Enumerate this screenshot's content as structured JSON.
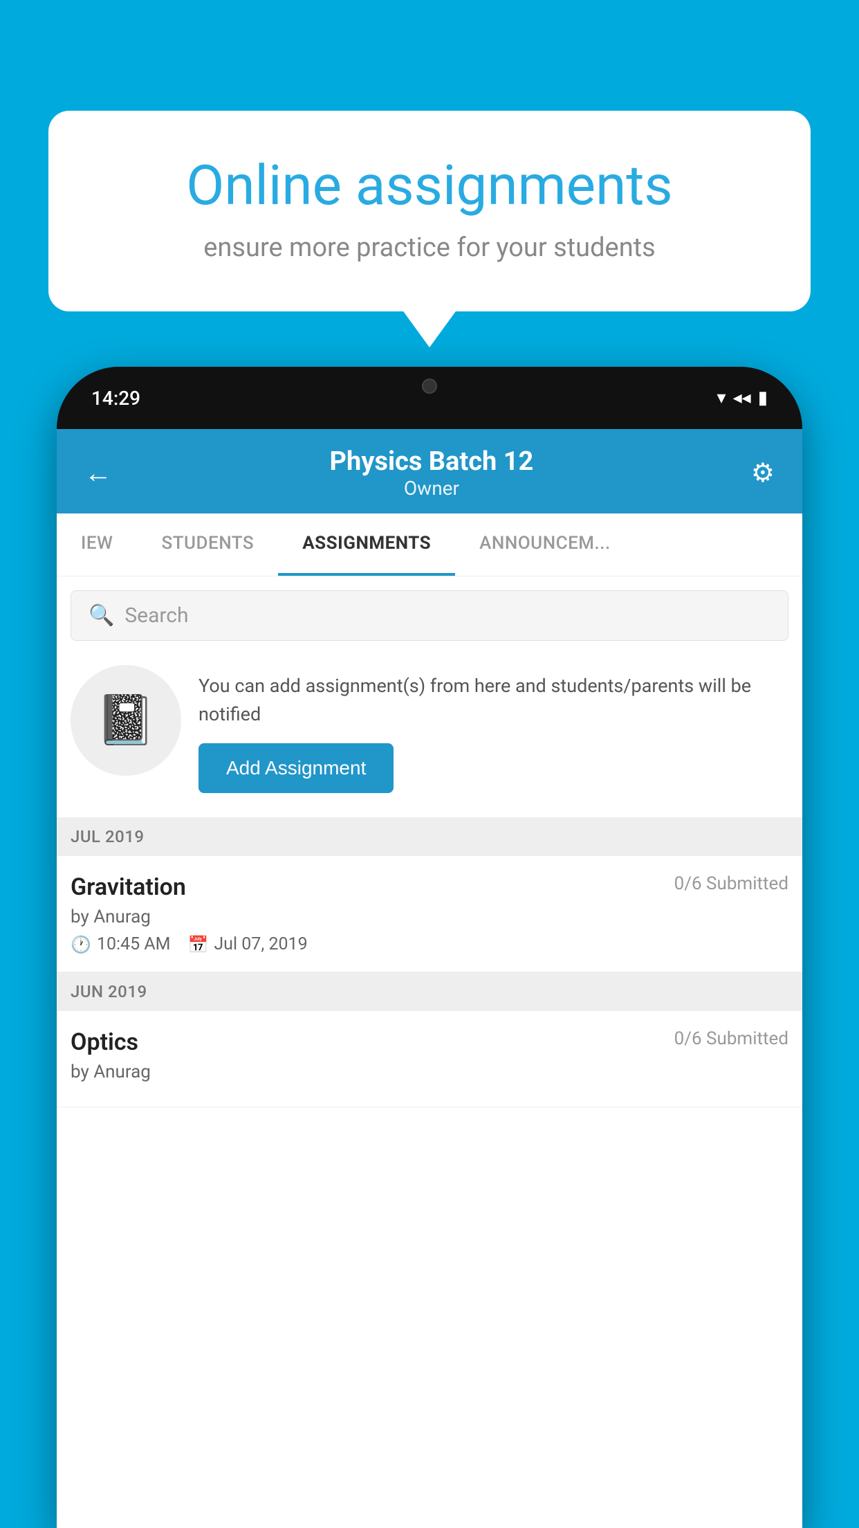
{
  "background_color": "#00AADD",
  "speech_bubble": {
    "title": "Online assignments",
    "subtitle": "ensure more practice for your students"
  },
  "phone": {
    "time": "14:29",
    "header": {
      "title": "Physics Batch 12",
      "subtitle": "Owner",
      "back_label": "←",
      "settings_label": "⚙"
    },
    "tabs": [
      {
        "label": "IEW",
        "active": false
      },
      {
        "label": "STUDENTS",
        "active": false
      },
      {
        "label": "ASSIGNMENTS",
        "active": true
      },
      {
        "label": "ANNOUNCEM...",
        "active": false
      }
    ],
    "search": {
      "placeholder": "Search"
    },
    "promo": {
      "text": "You can add assignment(s) from here and students/parents will be notified",
      "button_label": "Add Assignment"
    },
    "sections": [
      {
        "month_label": "JUL 2019",
        "assignments": [
          {
            "name": "Gravitation",
            "submitted": "0/6 Submitted",
            "by": "by Anurag",
            "time": "10:45 AM",
            "date": "Jul 07, 2019"
          }
        ]
      },
      {
        "month_label": "JUN 2019",
        "assignments": [
          {
            "name": "Optics",
            "submitted": "0/6 Submitted",
            "by": "by Anurag",
            "time": "",
            "date": ""
          }
        ]
      }
    ]
  }
}
